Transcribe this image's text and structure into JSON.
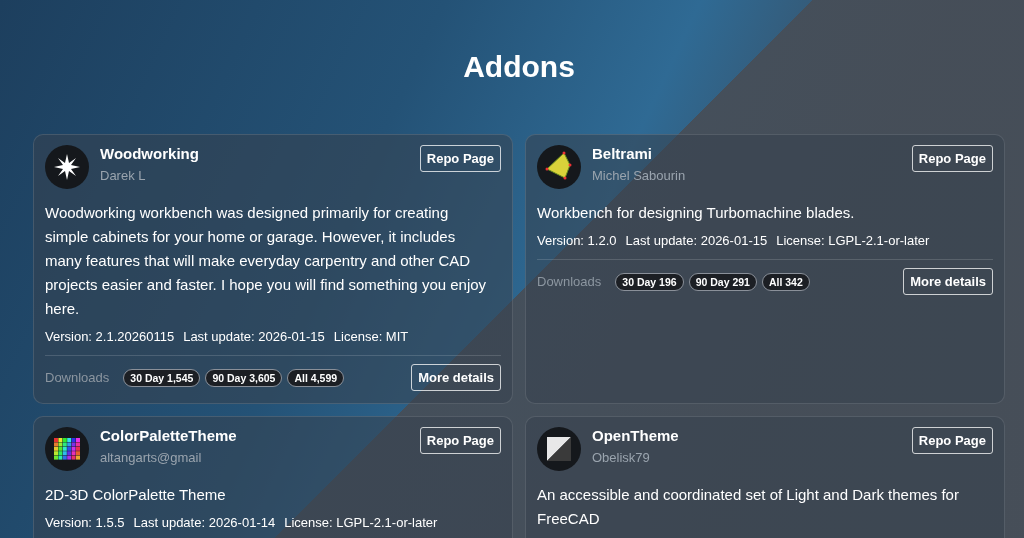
{
  "page_title": "Addons",
  "addons": [
    {
      "name": "Woodworking",
      "author": "Darek L",
      "kind": "star",
      "description": "Woodworking workbench was designed primarily for creating simple cabinets for your home or garage. However, it includes many features that will make everyday carpentry and other CAD projects easier and faster. I hope you will find something you enjoy here.",
      "meta": [
        "Version: 2.1.20260115",
        "Last update: 2026-01-15",
        "License: MIT"
      ],
      "repo_button": "Repo Page",
      "downloads_label": "Downloads",
      "downloads": [
        "30 Day 1,545",
        "90 Day 3,605",
        "All 4,599"
      ],
      "details_button": "More details"
    },
    {
      "name": "Beltrami",
      "author": "Michel Sabourin",
      "kind": "blade",
      "description": "Workbench for designing Turbomachine blades.",
      "meta": [
        "Version: 1.2.0",
        "Last update: 2026-01-15",
        "License: LGPL-2.1-or-later"
      ],
      "repo_button": "Repo Page",
      "downloads_label": "Downloads",
      "downloads": [
        "30 Day 196",
        "90 Day 291",
        "All 342"
      ],
      "details_button": "More details"
    },
    {
      "name": "ColorPaletteTheme",
      "author": "altangarts@gmail",
      "kind": "palette",
      "description": "2D-3D ColorPalette Theme",
      "meta": [
        "Version: 1.5.5",
        "Last update: 2026-01-14",
        "License: LGPL-2.1-or-later"
      ],
      "repo_button": "Repo Page"
    },
    {
      "name": "OpenTheme",
      "author": "Obelisk79",
      "kind": "split",
      "description": "An accessible and coordinated set of Light and Dark themes for FreeCAD",
      "repo_button": "Repo Page"
    }
  ]
}
